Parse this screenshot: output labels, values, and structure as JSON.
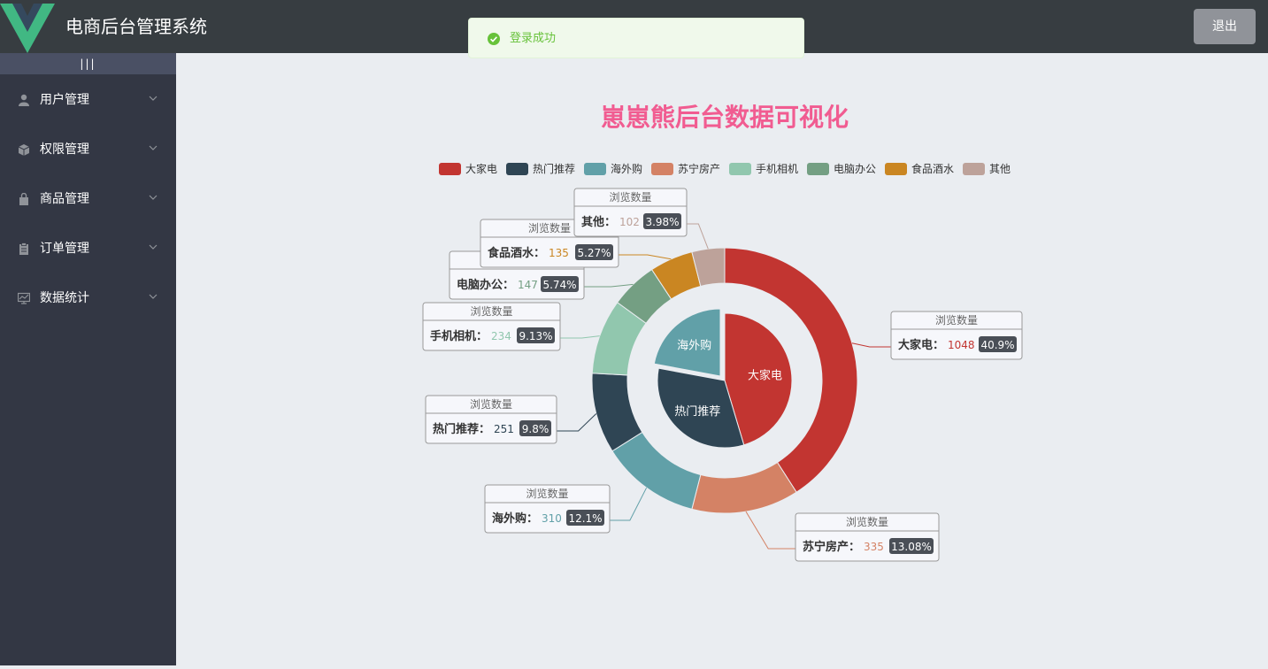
{
  "header": {
    "title": "电商后台管理系统",
    "logout_label": "退出"
  },
  "toast": {
    "message": "登录成功",
    "color": "#67c23a"
  },
  "sidebar": {
    "toggle_label": "|||",
    "items": [
      {
        "label": "用户管理",
        "icon": "user-icon"
      },
      {
        "label": "权限管理",
        "icon": "box-icon"
      },
      {
        "label": "商品管理",
        "icon": "bag-icon"
      },
      {
        "label": "订单管理",
        "icon": "clipboard-icon"
      },
      {
        "label": "数据统计",
        "icon": "chart-icon"
      }
    ]
  },
  "chart_data": {
    "type": "pie",
    "title": "崽崽熊后台数据可视化",
    "series_name": "浏览数量",
    "legend_position": "top",
    "categories": [
      "大家电",
      "热门推荐",
      "海外购",
      "苏宁房产",
      "手机相机",
      "电脑办公",
      "食品酒水",
      "其他"
    ],
    "colors": [
      "#c23531",
      "#2f4554",
      "#61a0a8",
      "#d48265",
      "#91c7ae",
      "#749f83",
      "#ca8622",
      "#bda29a"
    ],
    "outer_ring": [
      {
        "name": "大家电",
        "value": 1048,
        "percent": "40.9%"
      },
      {
        "name": "苏宁房产",
        "value": 335,
        "percent": "13.08%"
      },
      {
        "name": "海外购",
        "value": 310,
        "percent": "12.1%"
      },
      {
        "name": "热门推荐",
        "value": 251,
        "percent": "9.8%"
      },
      {
        "name": "手机相机",
        "value": 234,
        "percent": "9.13%"
      },
      {
        "name": "电脑办公",
        "value": 147,
        "percent": "5.74%"
      },
      {
        "name": "食品酒水",
        "value": 135,
        "percent": "5.27%"
      },
      {
        "name": "其他",
        "value": 102,
        "percent": "3.98%"
      }
    ],
    "inner_pie": [
      {
        "name": "大家电",
        "value": 1048
      },
      {
        "name": "热门推荐",
        "value": 751
      },
      {
        "name": "海外购",
        "value": 510
      }
    ]
  }
}
